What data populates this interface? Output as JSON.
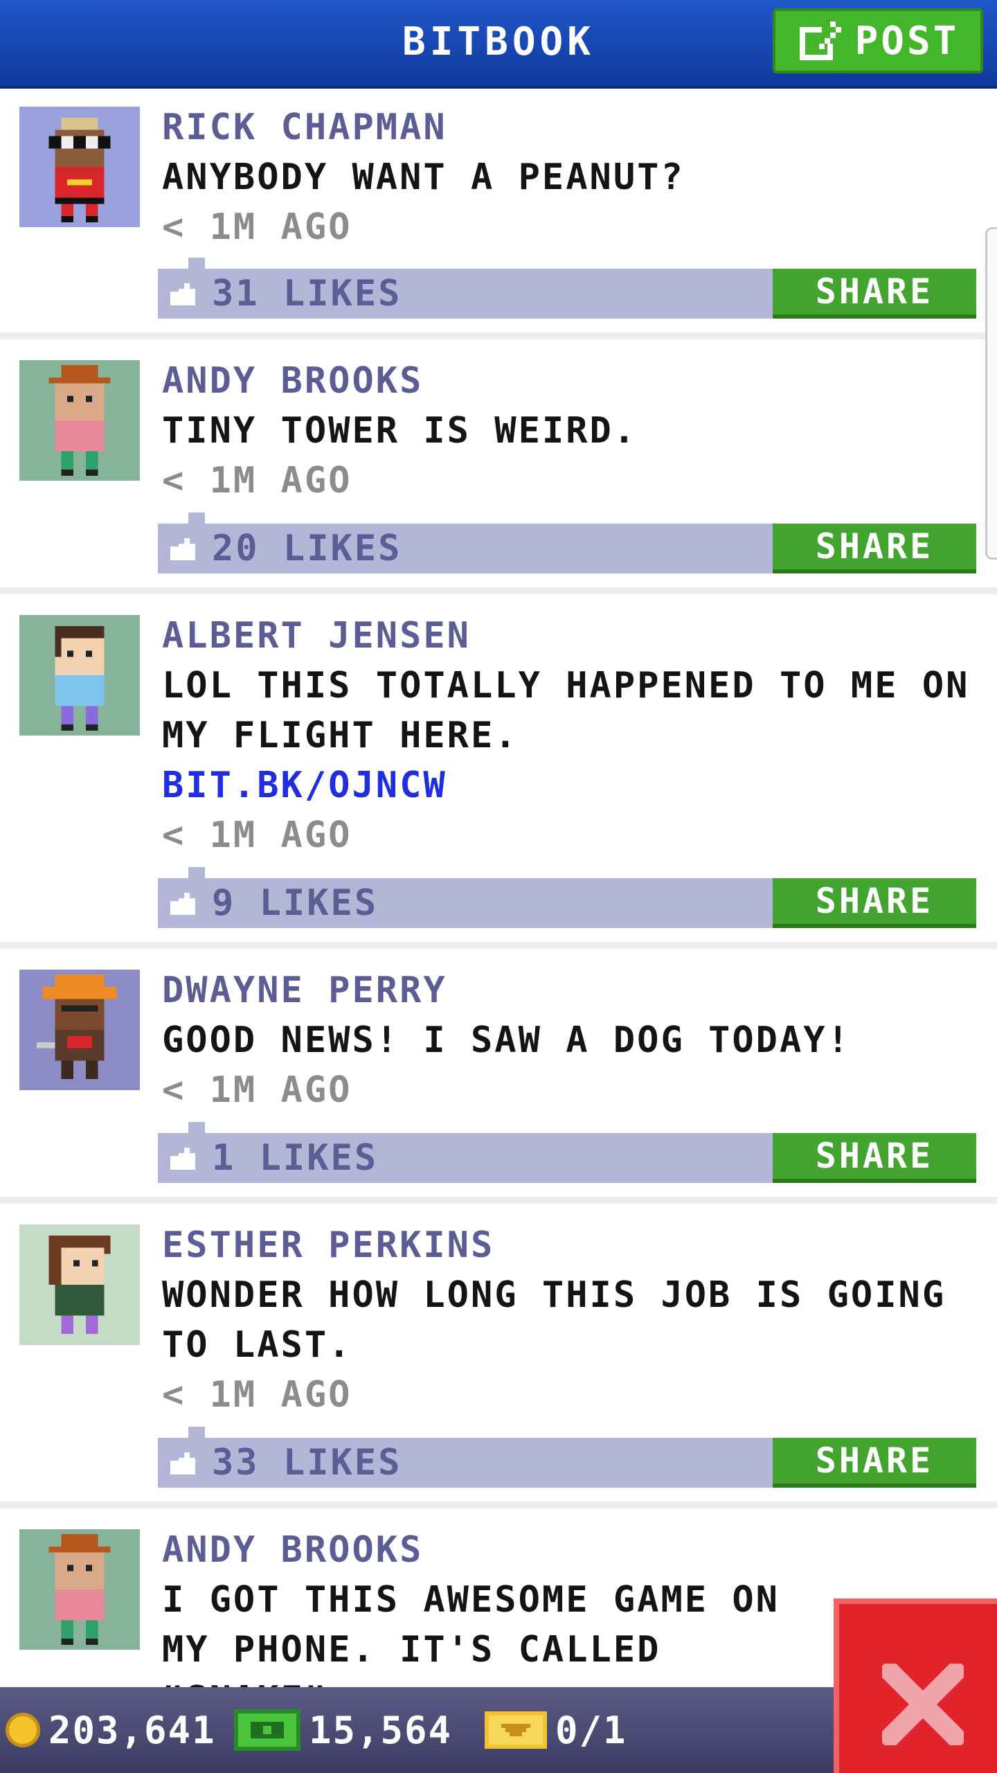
{
  "header": {
    "title": "BITBOOK",
    "post_label": "POST"
  },
  "posts": [
    {
      "author": "RICK CHAPMAN",
      "message": "ANYBODY WANT A PEANUT?",
      "link": "",
      "time": "< 1M AGO",
      "likes": "31 LIKES",
      "share": "SHARE",
      "avatar_bg": "#9aa2de"
    },
    {
      "author": "ANDY BROOKS",
      "message": "TINY TOWER IS WEIRD.",
      "link": "",
      "time": "< 1M AGO",
      "likes": "20 LIKES",
      "share": "SHARE",
      "avatar_bg": "#86b39a"
    },
    {
      "author": "ALBERT JENSEN",
      "message": "LOL THIS TOTALLY HAPPENED TO ME ON MY FLIGHT HERE.",
      "link": "BIT.BK/OJNCW",
      "time": "< 1M AGO",
      "likes": "9 LIKES",
      "share": "SHARE",
      "avatar_bg": "#86b39a"
    },
    {
      "author": "DWAYNE PERRY",
      "message": "GOOD NEWS! I SAW A DOG TODAY!",
      "link": "",
      "time": "< 1M AGO",
      "likes": "1 LIKES",
      "share": "SHARE",
      "avatar_bg": "#8e8cc4"
    },
    {
      "author": "ESTHER PERKINS",
      "message": "WONDER HOW LONG THIS JOB IS GOING TO LAST.",
      "link": "",
      "time": "< 1M AGO",
      "likes": "33 LIKES",
      "share": "SHARE",
      "avatar_bg": "#c4dcc6"
    },
    {
      "author": "ANDY BROOKS",
      "message": "I GOT THIS AWESOME GAME ON MY PHONE. IT'S CALLED \"SNAKE\".",
      "link": "",
      "time": "",
      "likes": "",
      "share": "",
      "avatar_bg": "#86b39a"
    }
  ],
  "status": {
    "coins": "203,641",
    "bux": "15,564",
    "tickets": "0/1"
  },
  "colors": {
    "header_blue": "#1a4ab8",
    "share_green": "#43a52f",
    "like_bar": "#b4b6d8",
    "author_purple": "#5d5d96",
    "link_blue": "#1f2ee0",
    "close_red": "#e1232c"
  },
  "icons": {
    "post": "edit-icon",
    "like": "thumbs-up-icon",
    "coin": "coin-icon",
    "bux": "bux-icon",
    "ticket": "ticket-icon",
    "close": "close-icon"
  }
}
